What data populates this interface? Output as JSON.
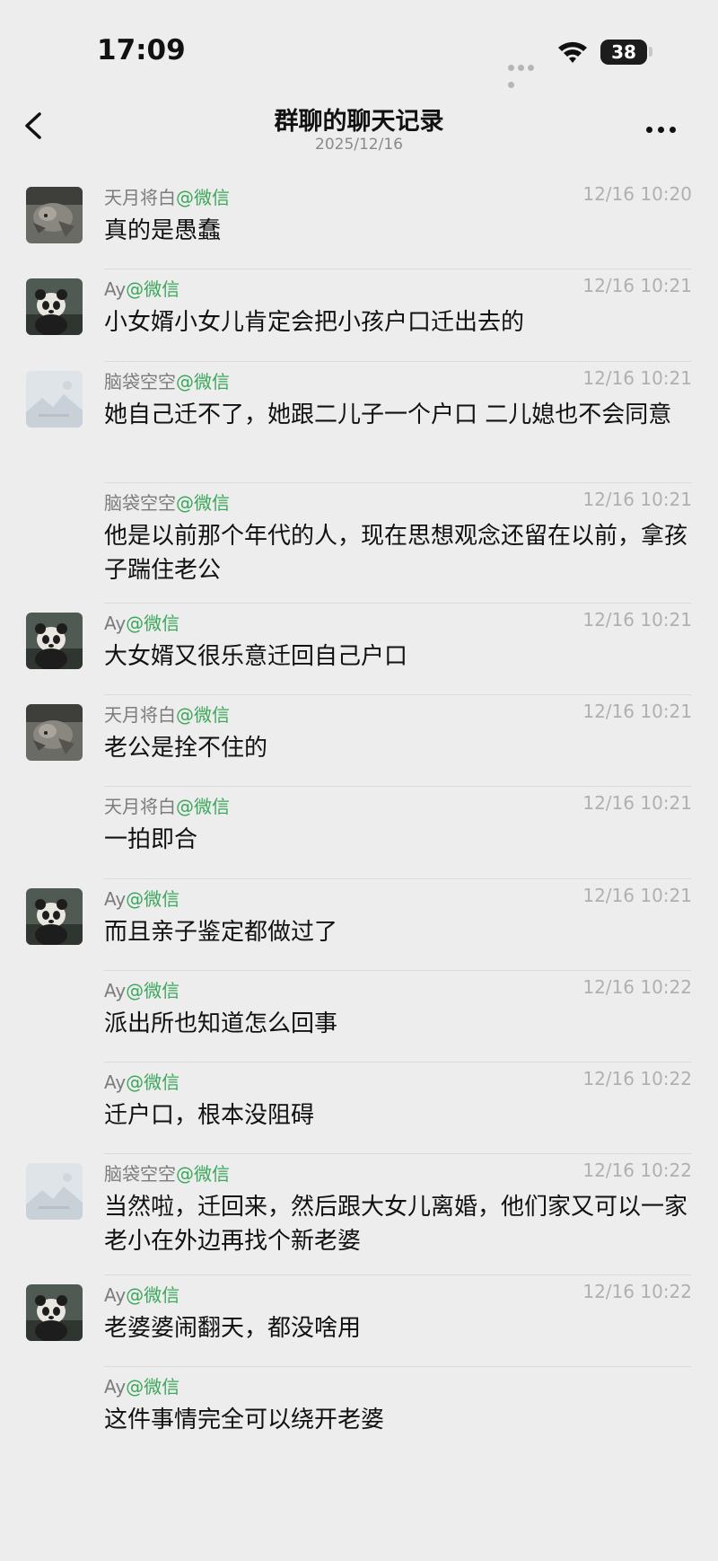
{
  "status_bar": {
    "time": "17:09",
    "battery": "38"
  },
  "nav": {
    "title": "群聊的聊天记录",
    "subtitle": "2025/12/16"
  },
  "messages": [
    {
      "sender": "天月将白",
      "suffix": "@微信",
      "time": "12/16 10:20",
      "text": "真的是愚蠢",
      "avatar": "cat"
    },
    {
      "sender": "Ay",
      "suffix": "@微信",
      "time": "12/16 10:21",
      "text": "小女婿小女儿肯定会把小孩户口迁出去的",
      "avatar": "panda"
    },
    {
      "sender": "脑袋空空",
      "suffix": "@微信",
      "time": "12/16 10:21",
      "text": "她自己迁不了，她跟二儿子一个户口 二儿媳也不会同意",
      "avatar": "placeholder"
    },
    {
      "sender": "脑袋空空",
      "suffix": "@微信",
      "time": "12/16 10:21",
      "text": "他是以前那个年代的人，现在思想观念还留在以前，拿孩子踹住老公",
      "avatar": "none"
    },
    {
      "sender": "Ay",
      "suffix": "@微信",
      "time": "12/16 10:21",
      "text": "大女婿又很乐意迁回自己户口",
      "avatar": "panda"
    },
    {
      "sender": "天月将白",
      "suffix": "@微信",
      "time": "12/16 10:21",
      "text": "老公是拴不住的",
      "avatar": "cat"
    },
    {
      "sender": "天月将白",
      "suffix": "@微信",
      "time": "12/16 10:21",
      "text": "一拍即合",
      "avatar": "none"
    },
    {
      "sender": "Ay",
      "suffix": "@微信",
      "time": "12/16 10:21",
      "text": "而且亲子鉴定都做过了",
      "avatar": "panda"
    },
    {
      "sender": "Ay",
      "suffix": "@微信",
      "time": "12/16 10:22",
      "text": "派出所也知道怎么回事",
      "avatar": "none"
    },
    {
      "sender": "Ay",
      "suffix": "@微信",
      "time": "12/16 10:22",
      "text": "迁户口，根本没阻碍",
      "avatar": "none"
    },
    {
      "sender": "脑袋空空",
      "suffix": "@微信",
      "time": "12/16 10:22",
      "text": "当然啦，迁回来，然后跟大女儿离婚，他们家又可以一家老小在外边再找个新老婆",
      "avatar": "placeholder"
    },
    {
      "sender": "Ay",
      "suffix": "@微信",
      "time": "12/16 10:22",
      "text": "老婆婆闹翻天，都没啥用",
      "avatar": "panda"
    },
    {
      "sender": "Ay",
      "suffix": "@微信",
      "time": "",
      "text": "这件事情完全可以绕开老婆",
      "avatar": "none"
    }
  ]
}
